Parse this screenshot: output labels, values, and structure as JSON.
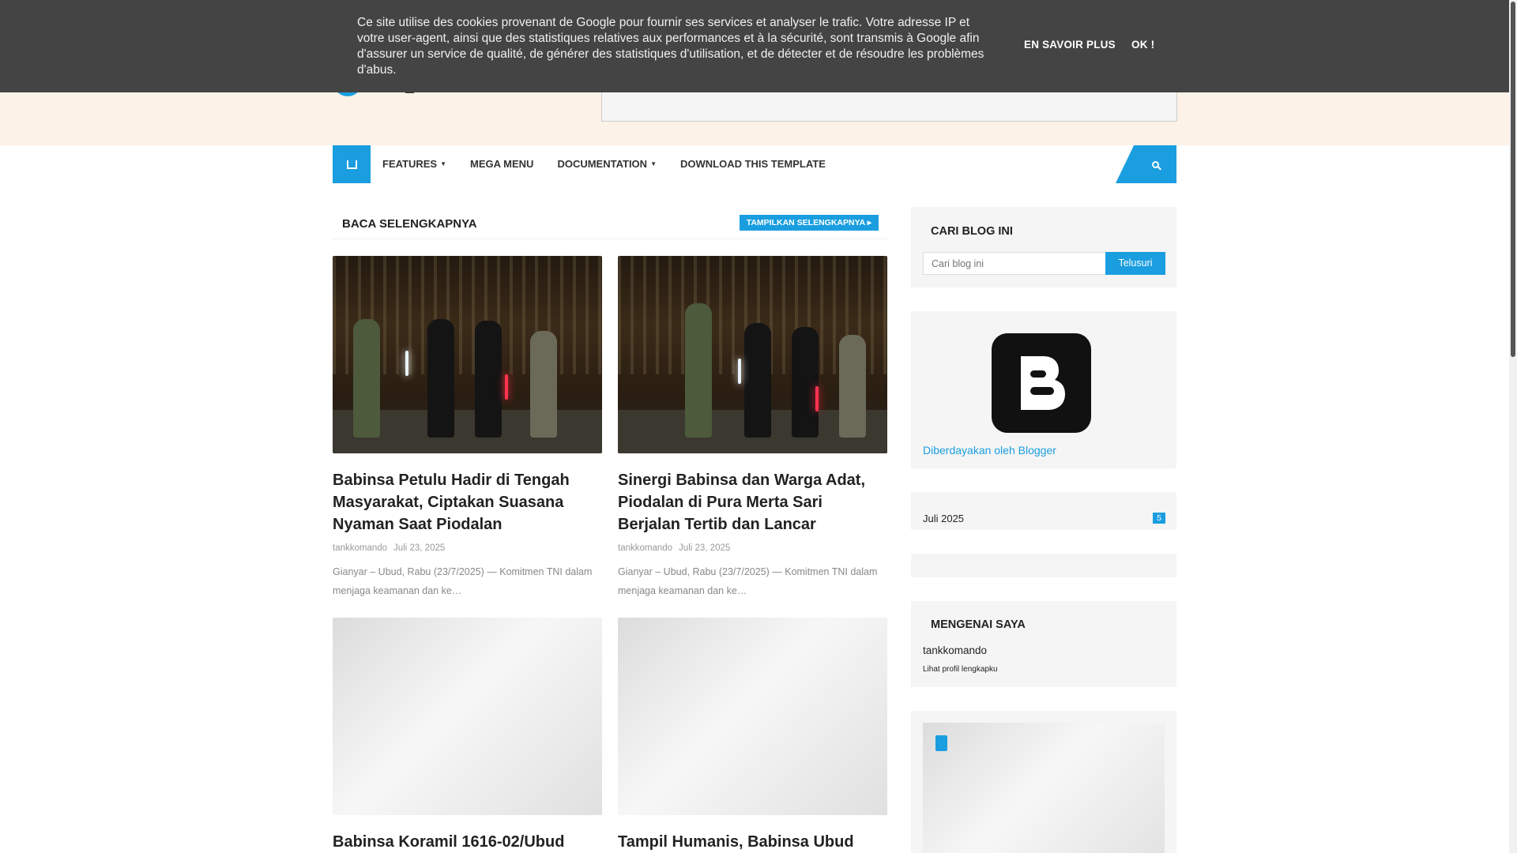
{
  "cookie": {
    "text": "Ce site utilise des cookies provenant de Google pour fournir ses services et analyser le trafic. Votre adresse IP et votre user-agent, ainsi que des statistiques relatives aux performances et à la sécurité, sont transmis à Google afin d'assurer un service de qualité, de générer des statistiques d'utilisation, et de détecter et de résoudre les problèmes d'abus.",
    "learn_more": "EN SAVOIR PLUS",
    "ok": "OK !"
  },
  "nav": {
    "home_icon": "home-icon",
    "items": [
      {
        "label": "FEATURES",
        "dropdown": true
      },
      {
        "label": "MEGA MENU",
        "dropdown": false
      },
      {
        "label": "DOCUMENTATION",
        "dropdown": true
      },
      {
        "label": "DOWNLOAD THIS TEMPLATE",
        "dropdown": false
      }
    ],
    "dropdown_glyph": "▼",
    "search_icon": "search-icon"
  },
  "main": {
    "section_title": "BACA SELENGKAPNYA",
    "show_more": "TAMPILKAN SELENGKAPNYA ▸",
    "posts": [
      {
        "title": "Babinsa Petulu Hadir di Tengah Masyarakat, Ciptakan Suasana Nyaman Saat Piodalan",
        "author": "tankkomando",
        "date": "Juli 23, 2025",
        "snippet": "Gianyar – Ubud, Rabu (23/7/2025) — Komitmen TNI dalam menjaga keamanan dan ke…"
      },
      {
        "title": "Sinergi Babinsa dan Warga Adat, Piodalan di Pura Merta Sari Berjalan Tertib dan Lancar",
        "author": "tankkomando",
        "date": "Juli 23, 2025",
        "snippet": "Gianyar – Ubud, Rabu (23/7/2025) — Komitmen TNI dalam menjaga keamanan dan ke…"
      },
      {
        "title": "Babinsa Koramil 1616-02/Ubud"
      },
      {
        "title": "Tampil Humanis, Babinsa Ubud"
      }
    ]
  },
  "sidebar": {
    "search": {
      "title": "CARI BLOG INI",
      "placeholder": "Cari blog ini",
      "button": "Telusuri"
    },
    "blogger": {
      "logo_icon": "blogger-logo-icon",
      "link": "Diberdayakan oleh Blogger"
    },
    "archive": {
      "label": "Juli 2025",
      "count": "5"
    },
    "about": {
      "title": "MENGENAI SAYA",
      "name": "tankkomando",
      "profile_link": "Lihat profil lengkapku"
    }
  },
  "colors": {
    "accent": "#1a9ee0",
    "header_bg": "#fdf2e8",
    "cookie_bg": "#444444",
    "widget_bg": "#f5f5f5"
  }
}
